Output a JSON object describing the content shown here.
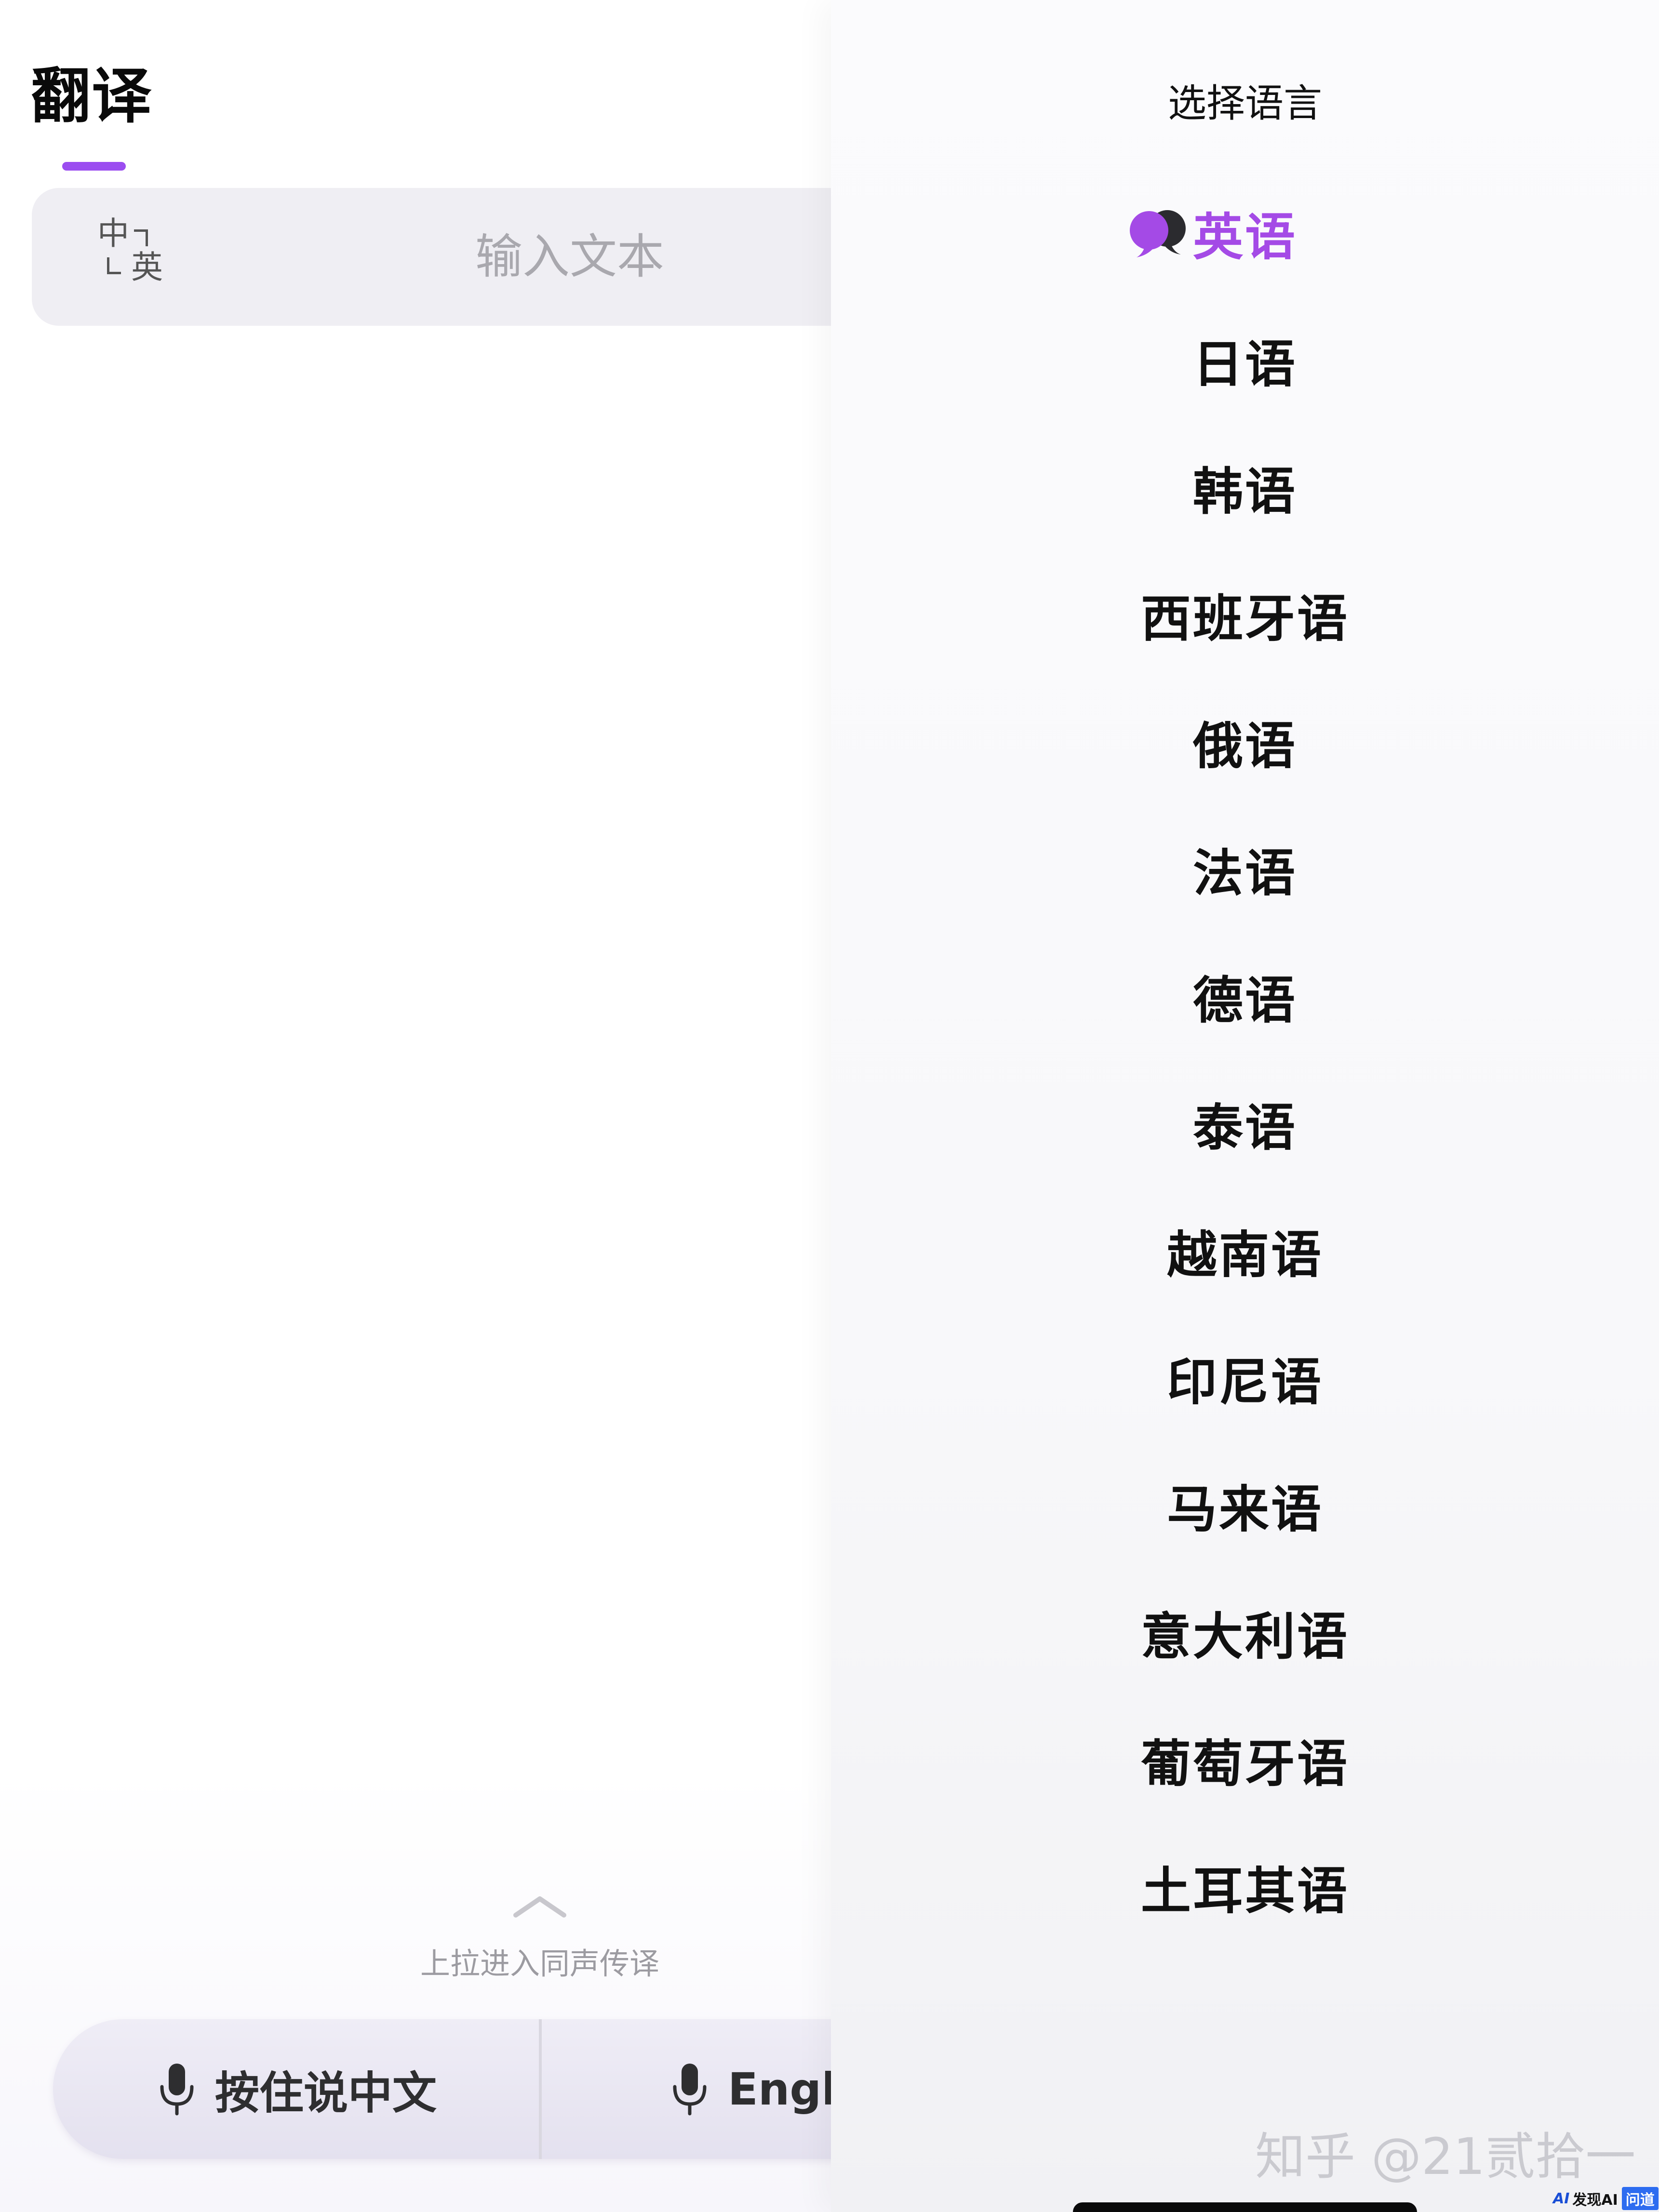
{
  "translate": {
    "title": "翻译",
    "lang_swap": {
      "from": "中",
      "to": "英"
    },
    "input_placeholder": "输入文本",
    "pull_up_hint": "上拉进入同声传译",
    "voice_left_label": "按住说中文",
    "voice_right_label": "Engl"
  },
  "panel": {
    "title": "选择语言",
    "languages": [
      {
        "label": "英语",
        "selected": true
      },
      {
        "label": "日语"
      },
      {
        "label": "韩语"
      },
      {
        "label": "西班牙语"
      },
      {
        "label": "俄语"
      },
      {
        "label": "法语"
      },
      {
        "label": "德语"
      },
      {
        "label": "泰语"
      },
      {
        "label": "越南语"
      },
      {
        "label": "印尼语"
      },
      {
        "label": "马来语"
      },
      {
        "label": "意大利语"
      },
      {
        "label": "葡萄牙语"
      },
      {
        "label": "土耳其语"
      }
    ]
  },
  "watermark": "知乎 @21贰拾一",
  "badge": {
    "mark": "AI",
    "text": "发现AI",
    "box": "问道"
  },
  "colors": {
    "accent": "#9b4df0",
    "selected_text": "#a44ae6",
    "input_bg": "#efeef3"
  },
  "icons": {
    "swap": "language-swap-icon",
    "mic": "microphone-icon",
    "chevron": "chevron-up-icon",
    "selected": "speech-bubbles-icon"
  }
}
